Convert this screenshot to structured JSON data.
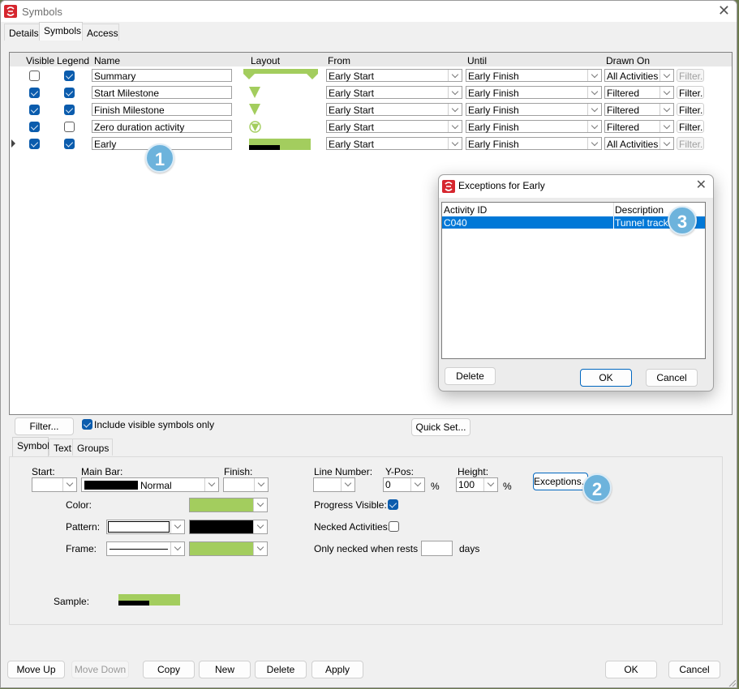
{
  "window": {
    "title": "Symbols",
    "tabs": [
      "Details",
      "Symbols",
      "Access"
    ],
    "active_tab": "Symbols"
  },
  "grid": {
    "columns": [
      "Visible",
      "Legend",
      "Name",
      "Layout",
      "From",
      "Until",
      "Drawn On"
    ],
    "rows": [
      {
        "visible": false,
        "legend": true,
        "name": "Summary",
        "layout": "summary-bar",
        "from": "Early Start",
        "until": "Early Finish",
        "drawn_on": "All Activities",
        "filter": "Filter...",
        "filter_enabled": false
      },
      {
        "visible": true,
        "legend": true,
        "name": "Start Milestone",
        "layout": "triangle-down",
        "from": "Early Start",
        "until": "Early Finish",
        "drawn_on": "Filtered",
        "filter": "Filter...",
        "filter_enabled": true
      },
      {
        "visible": true,
        "legend": true,
        "name": "Finish Milestone",
        "layout": "triangle-down",
        "from": "Early Start",
        "until": "Early Finish",
        "drawn_on": "Filtered",
        "filter": "Filter...",
        "filter_enabled": true
      },
      {
        "visible": true,
        "legend": false,
        "name": "Zero duration activity",
        "layout": "circle-triangle",
        "from": "Early Start",
        "until": "Early Finish",
        "drawn_on": "Filtered",
        "filter": "Filter...",
        "filter_enabled": true
      },
      {
        "visible": true,
        "legend": true,
        "name": "Early",
        "layout": "bar-with-progress",
        "from": "Early Start",
        "until": "Early Finish",
        "drawn_on": "All Activities",
        "filter": "Filter...",
        "filter_enabled": false,
        "selected": true
      }
    ]
  },
  "below_grid": {
    "filter_button": "Filter...",
    "include_visible_label": "Include visible symbols only",
    "include_visible_checked": true,
    "quick_set_button": "Quick Set..."
  },
  "inner_tabs": [
    "Symbol",
    "Text",
    "Groups"
  ],
  "symbol_tab": {
    "start_label": "Start:",
    "start_value": "",
    "main_bar_label": "Main Bar:",
    "main_bar_value": "Normal",
    "finish_label": "Finish:",
    "finish_value": "",
    "line_number_label": "Line Number:",
    "line_number_value": "",
    "ypos_label": "Y-Pos:",
    "ypos_value": "0",
    "ypos_unit": "%",
    "height_label": "Height:",
    "height_value": "100",
    "height_unit": "%",
    "exceptions_button": "Exceptions...",
    "color_label": "Color:",
    "pattern_label": "Pattern:",
    "frame_label": "Frame:",
    "progress_visible_label": "Progress Visible:",
    "progress_visible_checked": true,
    "necked_label": "Necked Activities:",
    "necked_checked": false,
    "only_necked_label": "Only necked when rests >",
    "only_necked_value": "",
    "days_label": "days",
    "sample_label": "Sample:",
    "colors": {
      "bar_green": "#a3cd5e",
      "pattern_black": "#000000",
      "pattern_white": "#ffffff",
      "frame_green": "#a3cd5e"
    }
  },
  "footer": {
    "move_up": "Move Up",
    "move_down": "Move Down",
    "copy": "Copy",
    "new": "New",
    "delete": "Delete",
    "apply": "Apply",
    "ok": "OK",
    "cancel": "Cancel"
  },
  "exceptions_dialog": {
    "title": "Exceptions for Early",
    "columns": [
      "Activity ID",
      "Description"
    ],
    "rows": [
      {
        "activity_id": "C040",
        "description": "Tunnel tracks",
        "selected": true
      }
    ],
    "delete_button": "Delete",
    "ok_button": "OK",
    "cancel_button": "Cancel"
  },
  "callouts": [
    "1",
    "2",
    "3"
  ]
}
